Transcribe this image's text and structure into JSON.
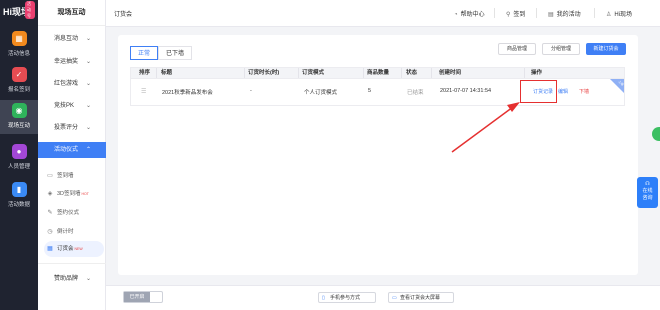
{
  "brand": {
    "logo_text": "Hi现场",
    "badge": "活动号"
  },
  "rail": [
    {
      "label": "活动信息",
      "icon": "calendar-icon",
      "color": "#f28a1e"
    },
    {
      "label": "报名签到",
      "icon": "signin-icon",
      "color": "#e74c52"
    },
    {
      "label": "现场互动",
      "icon": "interaction-icon",
      "color": "#2fb35b"
    },
    {
      "label": "人员管理",
      "icon": "people-icon",
      "color": "#a347d6"
    },
    {
      "label": "活动数据",
      "icon": "data-chart-icon",
      "color": "#3a8af5"
    }
  ],
  "side": {
    "title": "现场互动",
    "groups": [
      "消息互动",
      "幸运抽奖",
      "红包游戏",
      "竞技PK",
      "投票评分",
      "活动仪式"
    ],
    "subs": [
      {
        "label": "签到墙",
        "icon": "monitor-icon",
        "tag": ""
      },
      {
        "label": "3D签到墙",
        "icon": "cube-icon",
        "tag": "HOT"
      },
      {
        "label": "签约仪式",
        "icon": "pen-icon",
        "tag": ""
      },
      {
        "label": "倒计时",
        "icon": "clock-icon",
        "tag": ""
      },
      {
        "label": "订货会",
        "icon": "grid-icon",
        "tag": "NEW"
      }
    ],
    "bottom_group": "赞助品牌"
  },
  "topbar": {
    "breadcrumb": "订货会",
    "help": "帮助中心",
    "signin": "签到",
    "my_events": "我的活动",
    "user": "Hi现场"
  },
  "tabs": [
    "正常",
    "已下墙"
  ],
  "toolbar": {
    "goods": "商品管理",
    "group": "分组管理",
    "create": "新建订货会"
  },
  "table": {
    "headers": [
      "排序",
      "标题",
      "订货时长(时)",
      "订货模式",
      "商品数量",
      "状态",
      "创建时间",
      "操作"
    ],
    "rows": [
      {
        "sort": "☰",
        "title": "2021秋季新品发布会",
        "duration": "-",
        "mode": "个人订货模式",
        "count": "5",
        "status": "已结束",
        "created": "2021-07-07 14:31:54",
        "op_record": "订货记录",
        "op_edit": "编辑",
        "op_remove": "下墙",
        "ribbon": "上墙"
      }
    ]
  },
  "bottom": {
    "toggle": "已开启",
    "mobile": "手机参与方式",
    "screen": "查看订货会大屏幕"
  },
  "float": {
    "line1": "在线",
    "line2": "咨询"
  }
}
